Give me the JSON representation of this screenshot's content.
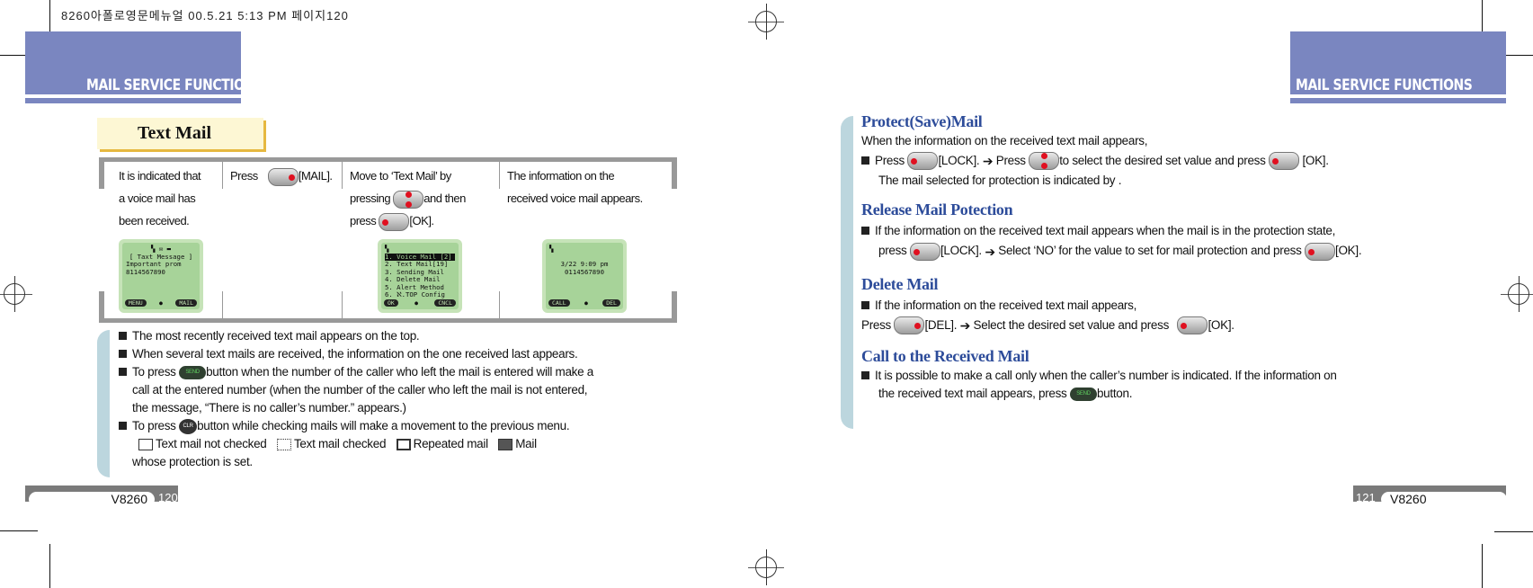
{
  "print_header": "8260아폴로영문메뉴얼   00.5.21 5:13 PM 페이지120",
  "left_page": {
    "header_title": "MAIL SERVICE FUNCTIONS",
    "section_title": "Text Mail",
    "steps": [
      {
        "lines": [
          "It is indicated that",
          "a voice mail has",
          "been received."
        ]
      },
      {
        "pre": "Press",
        "icon": "mail-soft-key-icon",
        "post": "[MAIL]."
      },
      {
        "line1": "Move to ‘Text Mail’ by",
        "line2_pre": "pressing",
        "line2_post": "and then",
        "line3_pre": "press",
        "line3_post": "[OK]."
      },
      {
        "lines": [
          "The information on the",
          "received voice mail appears."
        ]
      }
    ],
    "screens": [
      {
        "lines": [
          "[ Taxt Message ]",
          "Important prom",
          "8114567890"
        ],
        "left_soft": "MENU",
        "right_soft": "MAIL"
      },
      {
        "lines": [
          "1. Voice Mail [2]",
          "2. Text Mail[19]",
          "3. Sending Mail",
          "4. Delete Mail",
          "5. Alert Method",
          "6. ℵ.TOP Config"
        ],
        "left_soft": "OK",
        "right_soft": "CNCL"
      },
      {
        "lines": [
          "3/22  9:09  pm",
          "0114567890"
        ],
        "left_soft": "CALL",
        "right_soft": "DEL"
      }
    ],
    "notes": [
      "The most recently received text mail appears on the top.",
      "When  several text  mails  are received,  the information   on the one  received  last appears.",
      {
        "pre": "To press",
        "icon": "SEND",
        "post": "button when the  number of the caller who left the mail  is entered will make a",
        "cont": [
          "call at the entered number (when the number of the caller  who left the mail is not entered,",
          "the message,  “There is no caller’s number.” appears.)"
        ]
      },
      {
        "pre": "To press",
        "icon": "CLR",
        "post": "button  while checking  mails will make  a movement to  the previous menu."
      }
    ],
    "legend": [
      {
        "icon": "envelope-closed-icon",
        "label": "Text mail not checked"
      },
      {
        "icon": "envelope-open-icon",
        "label": "Text mail checked"
      },
      {
        "icon": "repeated-mail-icon",
        "label": "Repeated mail"
      },
      {
        "icon": "protected-mail-icon",
        "label": "Mail"
      }
    ],
    "legend_tail": "whose protection is set.",
    "footer_model": "V8260",
    "footer_page": "120"
  },
  "right_page": {
    "header_title": "MAIL SERVICE FUNCTIONS",
    "sections": [
      {
        "title": "Protect(Save)Mail",
        "intro": "When the information on the received text mail appears,",
        "b1": "Press",
        "b2": "[LOCK].",
        "b3": "Press",
        "b4": "to select the desired set value and press",
        "b5": "[OK].",
        "cont": "The mail selected for protection is indicated by        ."
      },
      {
        "title": "Release Mail Potection",
        "line1": "If the information on the received text mail appears when the mail is in the protection state,",
        "l2a": "press",
        "l2b": "[LOCK].",
        "l2c": "Select ‘NO’ for the value to set for  mail protection and press",
        "l2d": "[OK]."
      },
      {
        "title": "Delete Mail",
        "line1": "If the information on the received text mail appears,",
        "l2a": "Press",
        "l2b": "[DEL].",
        "l2c": "Select the desired set value and press",
        "l2d": "[OK]."
      },
      {
        "title": "Call to the Received Mail",
        "line1": "It is  possible to  make a  call only  when the  caller’s number  is indicated.  If the information on",
        "l2a": "the received text mail appears, press",
        "icon": "SEND",
        "l2b": "button."
      }
    ],
    "footer_model": "V8260",
    "footer_page": "121"
  }
}
